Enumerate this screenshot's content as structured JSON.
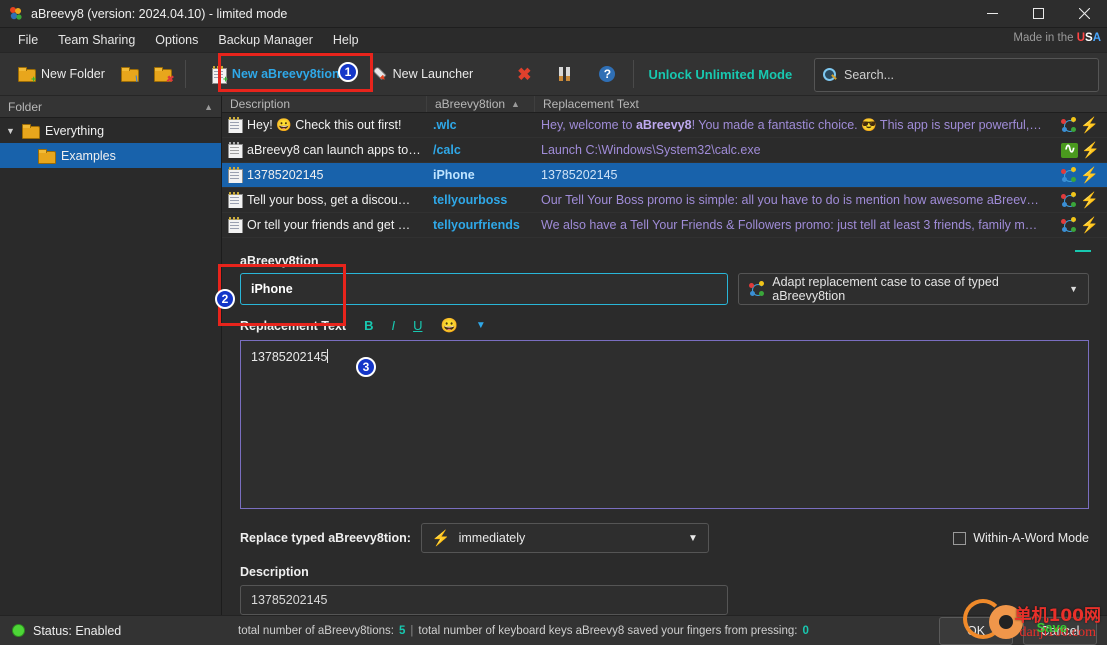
{
  "window": {
    "title": "aBreevy8 (version: 2024.04.10) - limited mode",
    "app_icon": "abreevy8-app-icon",
    "minimize": "—",
    "maximize": "☐",
    "close": "✕"
  },
  "menubar": {
    "items": [
      "File",
      "Team Sharing",
      "Options",
      "Backup Manager",
      "Help"
    ],
    "made_in": {
      "prefix": "Made in the ",
      "u": "U",
      "s": "S",
      "a": "A"
    }
  },
  "toolbar": {
    "new_folder": "New Folder",
    "edit_folder_icon": "edit-folder-icon",
    "delete_folder_icon": "delete-folder-icon",
    "new_abbreviation": "New aBreevy8tion",
    "new_launcher": "New Launcher",
    "delete_icon": "red-x-icon",
    "tools_icon": "tools-icon",
    "help_icon": "help-icon",
    "unlock": "Unlock Unlimited Mode",
    "search_placeholder": "Search..."
  },
  "sidebar": {
    "header": "Folder",
    "sort_arrow": "▲",
    "items": [
      {
        "label": "Everything",
        "level": 0,
        "expanded": true,
        "selected": false
      },
      {
        "label": "Examples",
        "level": 1,
        "expanded": false,
        "selected": true
      }
    ]
  },
  "list": {
    "columns": {
      "description": "Description",
      "abbreviation": "aBreevy8tion",
      "sort_arrow": "▲",
      "replacement": "Replacement Text"
    },
    "rows": [
      {
        "icon": "note-icon",
        "description": "Hey!  😀  Check this out first!",
        "abbreviation": ".wlc",
        "replacement_pre": "Hey, welcome to ",
        "replacement_bold": "aBreevy8",
        "replacement_post": "! You made a fantastic choice. 😎 This app is super powerful,…",
        "selected": false,
        "type_icon": "case-adapt-icon",
        "trigger_icon": "bolt-icon"
      },
      {
        "icon": "document-icon",
        "description": "aBreevy8 can launch apps to…",
        "abbreviation": "/calc",
        "replacement_pre": "Launch C:\\Windows\\System32\\calc.exe",
        "replacement_bold": "",
        "replacement_post": "",
        "selected": false,
        "type_icon": "green-app-icon",
        "trigger_icon": "bolt-icon"
      },
      {
        "icon": "note-icon",
        "description": "13785202145",
        "abbreviation": "iPhone",
        "replacement_pre": "13785202145",
        "replacement_bold": "",
        "replacement_post": "",
        "selected": true,
        "type_icon": "case-adapt-icon",
        "trigger_icon": "bolt-icon"
      },
      {
        "icon": "note-icon",
        "description": "Tell your boss, get a discou…",
        "abbreviation": "tellyourboss",
        "replacement_pre": "Our Tell Your Boss promo is simple: all you have to do is mention how awesome aBreev…",
        "replacement_bold": "",
        "replacement_post": "",
        "selected": false,
        "type_icon": "case-adapt-icon",
        "trigger_icon": "bolt-icon"
      },
      {
        "icon": "note-icon",
        "description": "Or tell your friends and get …",
        "abbreviation": "tellyourfriends",
        "replacement_pre": "We also have a Tell Your Friends & Followers promo: just tell at least 3 friends, family m…",
        "replacement_bold": "",
        "replacement_post": "",
        "selected": false,
        "type_icon": "case-adapt-icon",
        "trigger_icon": "bolt-icon"
      }
    ]
  },
  "editor": {
    "abbreviation_label": "aBreevy8tion",
    "abbreviation_value": "iPhone",
    "adapt_case_label": "Adapt replacement case to case of typed aBreevy8tion",
    "adapt_case_caret": "▼",
    "replacement_label": "Replacement Text",
    "format_bold": "B",
    "format_italic": "I",
    "format_underline": "U",
    "format_emoji": "😀",
    "format_more_caret": "▼",
    "replacement_value": "13785202145",
    "replace_when_label": "Replace typed aBreevy8tion:",
    "replace_when_value": "immediately",
    "replace_when_caret": "▼",
    "within_word_label": "Within-A-Word Mode",
    "within_word_checked": false,
    "description_label": "Description",
    "description_value": "13785202145"
  },
  "statusbar": {
    "status": "Status: Enabled",
    "total_label": "total number of aBreevy8tions:",
    "total_value": "5",
    "separator": "|",
    "keys_label": "total number of keyboard keys aBreevy8 saved your fingers from pressing:",
    "keys_value": "0",
    "ok": "OK",
    "cancel": "Cancel"
  },
  "annotations": {
    "step1": "1",
    "step2": "2",
    "step3": "3"
  },
  "watermark": {
    "cn": "单机100网",
    "en": "danji100.com",
    "save": "Save"
  },
  "colors": {
    "accent_blue": "#2fa8e8",
    "teal": "#18c8b0",
    "selection": "#1862ab",
    "annotation_red": "#e8241c",
    "step_badge": "#1436c8"
  }
}
